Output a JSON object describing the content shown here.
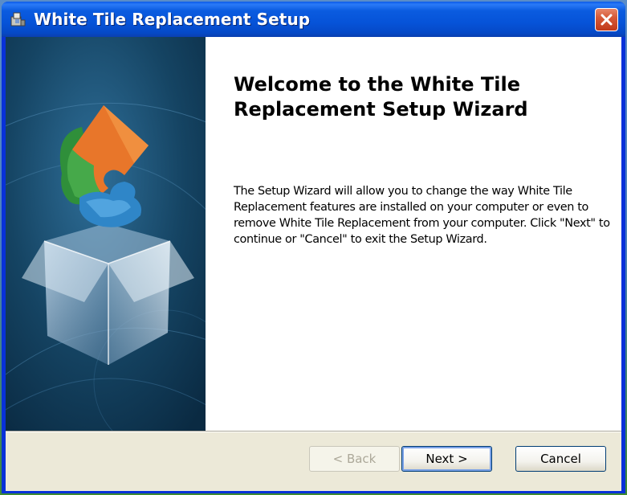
{
  "window": {
    "title": "White Tile Replacement Setup"
  },
  "content": {
    "heading": "Welcome to the White Tile Replacement Setup Wizard",
    "body": "The Setup Wizard will allow you to change the way White Tile Replacement features are installed on your computer or even to remove White Tile Replacement from your computer.  Click \"Next\" to continue or \"Cancel\" to exit the Setup Wizard."
  },
  "buttons": {
    "back": "< Back",
    "next": "Next >",
    "cancel": "Cancel"
  },
  "icons": {
    "title": "installer-icon",
    "close": "close-icon",
    "side": "puzzle-box-graphic"
  },
  "colors": {
    "titlebar": "#0653d8",
    "close": "#d65a38",
    "side_panel": "#0f3a5a",
    "dialog_face": "#ece9d8"
  }
}
